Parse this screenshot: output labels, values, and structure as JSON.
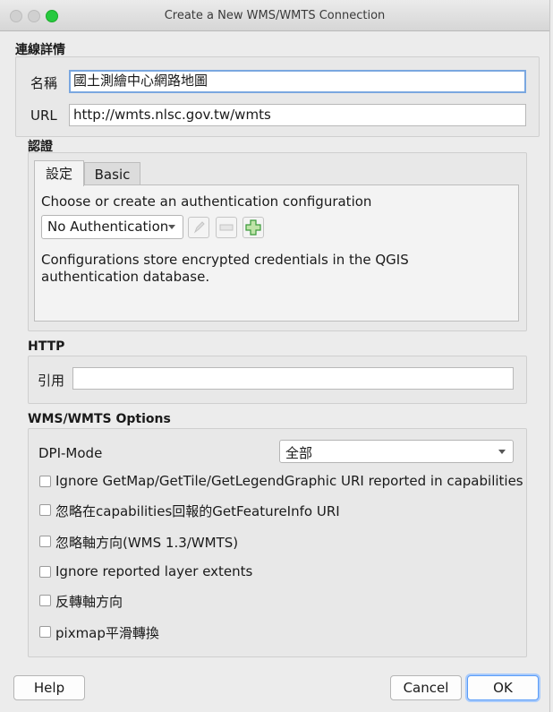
{
  "window": {
    "title": "Create a New WMS/WMTS Connection"
  },
  "connection": {
    "section_title": "連線詳情",
    "name_label": "名稱",
    "name_value": "國土測繪中心網路地圖",
    "url_label": "URL",
    "url_value": "http://wmts.nlsc.gov.tw/wmts"
  },
  "auth": {
    "section_title": "認證",
    "tabs": [
      "設定",
      "Basic"
    ],
    "choose_text": "Choose or create an authentication configuration",
    "selected_config": "No Authentication",
    "info_text": "Configurations store encrypted credentials in the QGIS authentication database."
  },
  "http": {
    "section_title": "HTTP",
    "referer_label": "引用",
    "referer_value": ""
  },
  "options": {
    "section_title": "WMS/WMTS Options",
    "dpi_label": "DPI-Mode",
    "dpi_value": "全部",
    "checkboxes": [
      "Ignore GetMap/GetTile/GetLegendGraphic URI reported in capabilities",
      "忽略在capabilities回報的GetFeatureInfo URI",
      "忽略軸方向(WMS 1.3/WMTS)",
      "Ignore reported layer extents",
      "反轉軸方向",
      "pixmap平滑轉換"
    ]
  },
  "buttons": {
    "help": "Help",
    "cancel": "Cancel",
    "ok": "OK"
  },
  "colors": {
    "ok_border": "#5a9cf8",
    "focus_border": "#7aa7e0",
    "add_icon": "#3a9a3a"
  }
}
